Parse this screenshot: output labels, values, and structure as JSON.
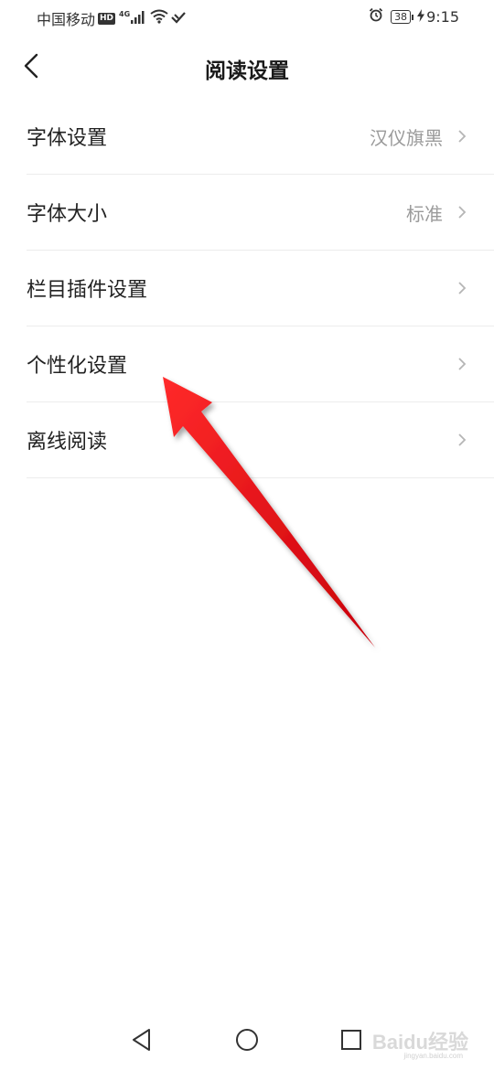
{
  "status_bar": {
    "carrier": "中国移动",
    "hd_badge": "HD",
    "network": "4G",
    "battery": "38",
    "time": "9:15",
    "icons": [
      "signal-icon",
      "wifi-icon",
      "hd-voice-icon",
      "alarm-icon",
      "charging-icon"
    ]
  },
  "header": {
    "title": "阅读设置",
    "back_icon": "chevron-left-icon"
  },
  "settings": {
    "items": [
      {
        "label": "字体设置",
        "value": "汉仪旗黑"
      },
      {
        "label": "字体大小",
        "value": "标准"
      },
      {
        "label": "栏目插件设置",
        "value": ""
      },
      {
        "label": "个性化设置",
        "value": ""
      },
      {
        "label": "离线阅读",
        "value": ""
      }
    ]
  },
  "annotation": {
    "arrow_color": "#e8141c",
    "points_to": "个性化设置"
  },
  "nav_bar": {
    "icons": [
      "nav-back-icon",
      "nav-home-icon",
      "nav-recent-icon"
    ]
  },
  "watermark": {
    "text": "Baidu经验",
    "sub": "jingyan.baidu.com"
  }
}
